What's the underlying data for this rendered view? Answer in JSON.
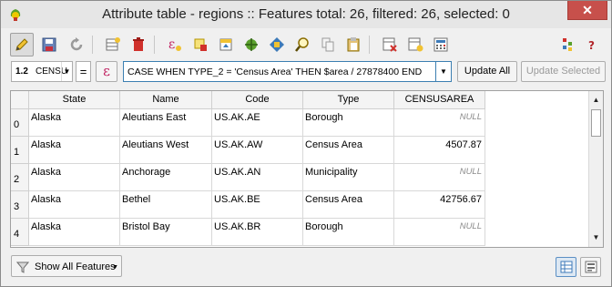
{
  "window": {
    "title": "Attribute table - regions :: Features total: 26, filtered: 26, selected: 0",
    "close_label": "✕"
  },
  "toolbar": {
    "buttons": [
      "toggle-editing-icon",
      "save-edits-icon",
      "reload-icon",
      "add-feature-icon",
      "delete-selected-icon",
      "select-by-expression-icon",
      "deselect-all-icon",
      "move-selection-to-top-icon",
      "pan-to-selected-icon",
      "zoom-to-selected-icon",
      "copy-rows-icon",
      "paste-features-icon",
      "delete-field-icon",
      "new-field-icon",
      "field-calculator-icon",
      "conditional-formatting-icon",
      "help-icon"
    ]
  },
  "calcbar": {
    "field_type_label": "1.2",
    "field_name": "CENSU",
    "equals_label": "=",
    "expression_label": "ε",
    "expression": "CASE WHEN TYPE_2 = 'Census Area' THEN $area / 27878400 END",
    "update_all_label": "Update All",
    "update_selected_label": "Update Selected"
  },
  "table": {
    "columns": [
      "State",
      "Name",
      "Code",
      "Type",
      "CENSUSAREA"
    ],
    "rows": [
      {
        "index": "0",
        "state": "Alaska",
        "name": "Aleutians East",
        "code": "US.AK.AE",
        "type": "Borough",
        "censusarea": "NULL"
      },
      {
        "index": "1",
        "state": "Alaska",
        "name": "Aleutians West",
        "code": "US.AK.AW",
        "type": "Census Area",
        "censusarea": "4507.87"
      },
      {
        "index": "2",
        "state": "Alaska",
        "name": "Anchorage",
        "code": "US.AK.AN",
        "type": "Municipality",
        "censusarea": "NULL"
      },
      {
        "index": "3",
        "state": "Alaska",
        "name": "Bethel",
        "code": "US.AK.BE",
        "type": "Census Area",
        "censusarea": "42756.67"
      },
      {
        "index": "4",
        "state": "Alaska",
        "name": "Bristol Bay",
        "code": "US.AK.BR",
        "type": "Borough",
        "censusarea": "NULL"
      }
    ]
  },
  "footer": {
    "show_all_label": "Show All Features"
  }
}
